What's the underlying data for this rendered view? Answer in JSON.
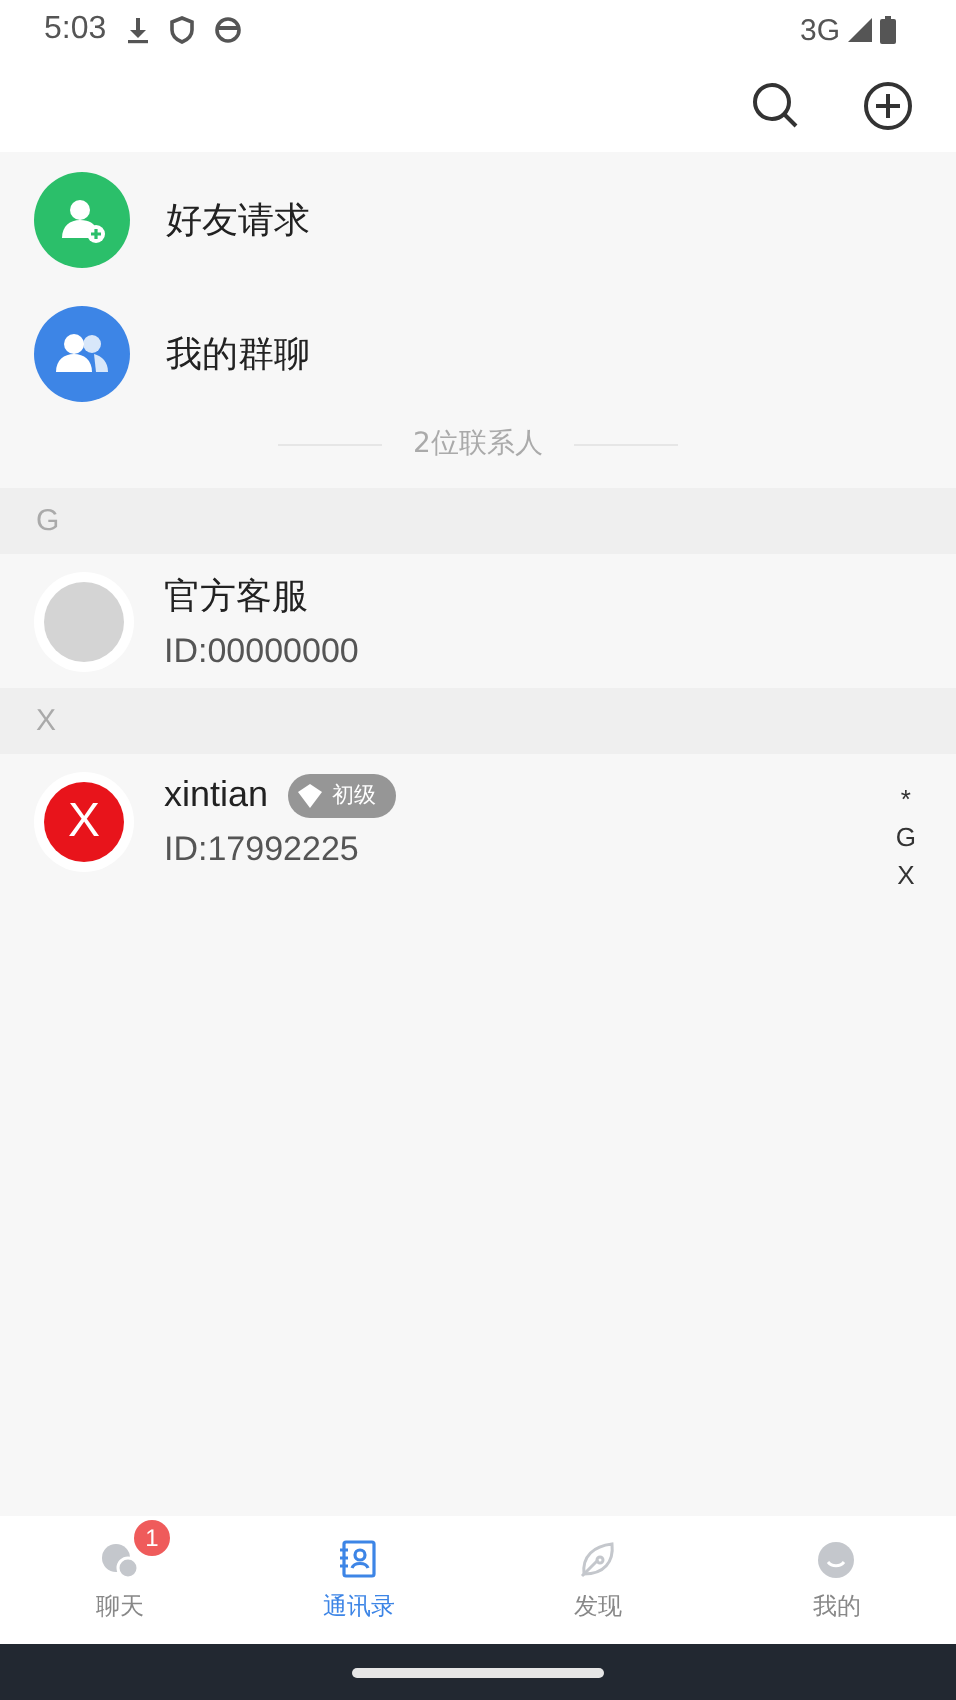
{
  "status_bar": {
    "time": "5:03",
    "network": "3G"
  },
  "shortcuts": [
    {
      "label": "好友请求",
      "kind": "request"
    },
    {
      "label": "我的群聊",
      "kind": "group"
    }
  ],
  "contact_count": "2位联系人",
  "sections": [
    {
      "letter": "G",
      "contacts": [
        {
          "name": "官方客服",
          "id": "ID:00000000",
          "avatar": {
            "kind": "blank"
          }
        }
      ]
    },
    {
      "letter": "X",
      "contacts": [
        {
          "name": "xintian",
          "id": "ID:17992225",
          "badge": "初级",
          "avatar": {
            "kind": "letter",
            "text": "X"
          }
        }
      ]
    }
  ],
  "index_letters": [
    "*",
    "G",
    "X"
  ],
  "tabs": [
    {
      "label": "聊天",
      "kind": "chat",
      "selected": false,
      "badge": "1"
    },
    {
      "label": "通讯录",
      "kind": "contacts",
      "selected": true
    },
    {
      "label": "发现",
      "kind": "discover",
      "selected": false
    },
    {
      "label": "我的",
      "kind": "me",
      "selected": false
    }
  ]
}
